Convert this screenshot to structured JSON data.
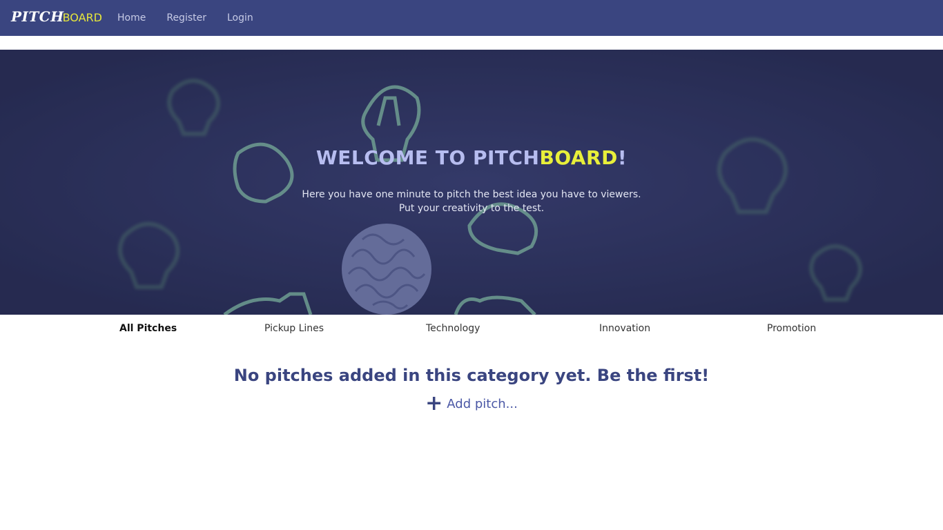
{
  "nav": {
    "brand_pitch": "PITCH",
    "brand_board": "BOARD",
    "links": [
      "Home",
      "Register",
      "Login"
    ]
  },
  "hero": {
    "title_main": "WELCOME TO PITCH",
    "title_accent": "BOARD",
    "title_end": "!",
    "subtitle_line1": "Here you have one minute to pitch the best idea you have to viewers.",
    "subtitle_line2": "Put your creativity to the test."
  },
  "categories": [
    "All Pitches",
    "Pickup Lines",
    "Technology",
    "Innovation",
    "Promotion"
  ],
  "active_category": "All Pitches",
  "empty_message": "No pitches added in this category yet. Be the first!",
  "add_pitch_label": "Add pitch...",
  "colors": {
    "navbar": "#3a4580",
    "accent": "#e8ef3a",
    "hero_bg": "#2f3560",
    "heading": "#3a4580"
  }
}
